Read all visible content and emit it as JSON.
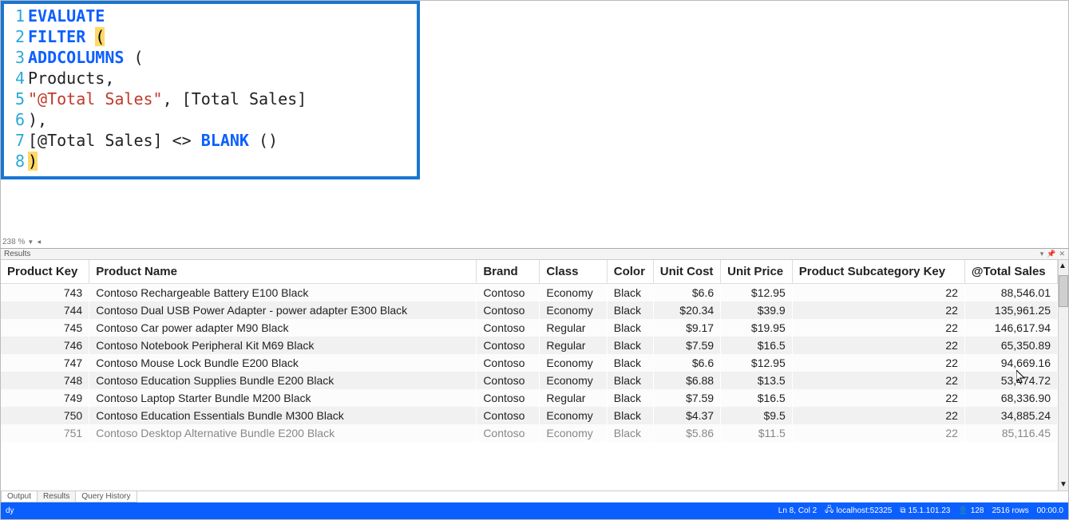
{
  "editor": {
    "zoom": "238 %",
    "lines": [
      {
        "n": 1,
        "tokens": [
          {
            "t": "EVALUATE",
            "c": "kw"
          }
        ]
      },
      {
        "n": 2,
        "tokens": [
          {
            "t": "FILTER",
            "c": "kw"
          },
          {
            "t": " "
          },
          {
            "t": "(",
            "c": "paren-hl"
          }
        ]
      },
      {
        "n": 3,
        "indent": 1,
        "tokens": [
          {
            "t": "ADDCOLUMNS",
            "c": "fn"
          },
          {
            "t": " ("
          }
        ]
      },
      {
        "n": 4,
        "indent": 2,
        "tokens": [
          {
            "t": "Products,"
          }
        ]
      },
      {
        "n": 5,
        "indent": 2,
        "tokens": [
          {
            "t": "\"@Total Sales\"",
            "c": "str"
          },
          {
            "t": ", [Total Sales]"
          }
        ]
      },
      {
        "n": 6,
        "indent": 1,
        "tokens": [
          {
            "t": "),"
          }
        ]
      },
      {
        "n": 7,
        "indent": 1,
        "tokens": [
          {
            "t": "[@Total Sales] <> "
          },
          {
            "t": "BLANK",
            "c": "fn"
          },
          {
            "t": " ()"
          }
        ]
      },
      {
        "n": 8,
        "tokens": [
          {
            "t": ")",
            "c": "paren-hl"
          }
        ]
      }
    ]
  },
  "results": {
    "panel_title": "Results",
    "columns": [
      {
        "key": "product_key",
        "label": "Product Key",
        "cls": "col-key num"
      },
      {
        "key": "product_name",
        "label": "Product Name",
        "cls": "col-name"
      },
      {
        "key": "brand",
        "label": "Brand",
        "cls": "col-brand"
      },
      {
        "key": "class",
        "label": "Class",
        "cls": "col-class"
      },
      {
        "key": "color",
        "label": "Color",
        "cls": "col-color"
      },
      {
        "key": "unit_cost",
        "label": "Unit Cost",
        "cls": "col-ucost num"
      },
      {
        "key": "unit_price",
        "label": "Unit Price",
        "cls": "col-uprice num"
      },
      {
        "key": "subcat_key",
        "label": "Product Subcategory Key",
        "cls": "col-subk num"
      },
      {
        "key": "total_sales",
        "label": "@Total Sales",
        "cls": "col-tot num"
      }
    ],
    "rows": [
      {
        "product_key": "743",
        "product_name": "Contoso Rechargeable Battery E100 Black",
        "brand": "Contoso",
        "class": "Economy",
        "color": "Black",
        "unit_cost": "$6.6",
        "unit_price": "$12.95",
        "subcat_key": "22",
        "total_sales": "88,546.01"
      },
      {
        "product_key": "744",
        "product_name": "Contoso Dual USB Power Adapter - power adapter E300 Black",
        "brand": "Contoso",
        "class": "Economy",
        "color": "Black",
        "unit_cost": "$20.34",
        "unit_price": "$39.9",
        "subcat_key": "22",
        "total_sales": "135,961.25"
      },
      {
        "product_key": "745",
        "product_name": "Contoso Car power adapter M90 Black",
        "brand": "Contoso",
        "class": "Regular",
        "color": "Black",
        "unit_cost": "$9.17",
        "unit_price": "$19.95",
        "subcat_key": "22",
        "total_sales": "146,617.94"
      },
      {
        "product_key": "746",
        "product_name": "Contoso Notebook Peripheral Kit M69 Black",
        "brand": "Contoso",
        "class": "Regular",
        "color": "Black",
        "unit_cost": "$7.59",
        "unit_price": "$16.5",
        "subcat_key": "22",
        "total_sales": "65,350.89"
      },
      {
        "product_key": "747",
        "product_name": "Contoso Mouse Lock Bundle E200 Black",
        "brand": "Contoso",
        "class": "Economy",
        "color": "Black",
        "unit_cost": "$6.6",
        "unit_price": "$12.95",
        "subcat_key": "22",
        "total_sales": "94,669.16"
      },
      {
        "product_key": "748",
        "product_name": "Contoso Education Supplies Bundle E200 Black",
        "brand": "Contoso",
        "class": "Economy",
        "color": "Black",
        "unit_cost": "$6.88",
        "unit_price": "$13.5",
        "subcat_key": "22",
        "total_sales": "53,474.72"
      },
      {
        "product_key": "749",
        "product_name": "Contoso Laptop Starter Bundle M200 Black",
        "brand": "Contoso",
        "class": "Regular",
        "color": "Black",
        "unit_cost": "$7.59",
        "unit_price": "$16.5",
        "subcat_key": "22",
        "total_sales": "68,336.90"
      },
      {
        "product_key": "750",
        "product_name": "Contoso Education Essentials Bundle M300 Black",
        "brand": "Contoso",
        "class": "Economy",
        "color": "Black",
        "unit_cost": "$4.37",
        "unit_price": "$9.5",
        "subcat_key": "22",
        "total_sales": "34,885.24"
      }
    ],
    "clipped_row": {
      "product_key": "751",
      "product_name": "Contoso Desktop Alternative Bundle E200 Black",
      "brand": "Contoso",
      "class": "Economy",
      "color": "Black",
      "unit_cost": "$5.86",
      "unit_price": "$11.5",
      "subcat_key": "22",
      "total_sales": "85,116.45"
    }
  },
  "bottom_tabs": [
    "Output",
    "Results",
    "Query History"
  ],
  "active_bottom_tab": 1,
  "status": {
    "left": "dy",
    "pos": "Ln 8, Col 2",
    "host": "localhost:52325",
    "ver": "15.1.101.23",
    "users": "128",
    "rows": "2516 rows",
    "time": "00:00.0"
  }
}
